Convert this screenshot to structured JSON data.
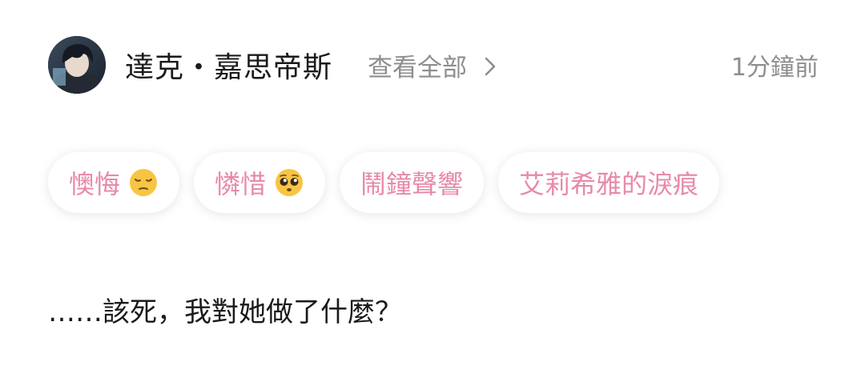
{
  "header": {
    "username": "達克・嘉思帝斯",
    "view_all_label": "查看全部",
    "timestamp": "1分鐘前",
    "avatar_icon": "user-avatar"
  },
  "tags": [
    {
      "label": "懊悔",
      "emoji": "pensive-face-emoji"
    },
    {
      "label": "憐惜",
      "emoji": "pleading-face-emoji"
    },
    {
      "label": "鬧鐘聲響"
    },
    {
      "label": "艾莉希雅的淚痕"
    }
  ],
  "message": {
    "text": "……該死，我對她做了什麼？"
  },
  "colors": {
    "tag_text": "#e78aa8",
    "secondary_text": "#8e8e8e",
    "primary_text": "#1a1a1a"
  }
}
